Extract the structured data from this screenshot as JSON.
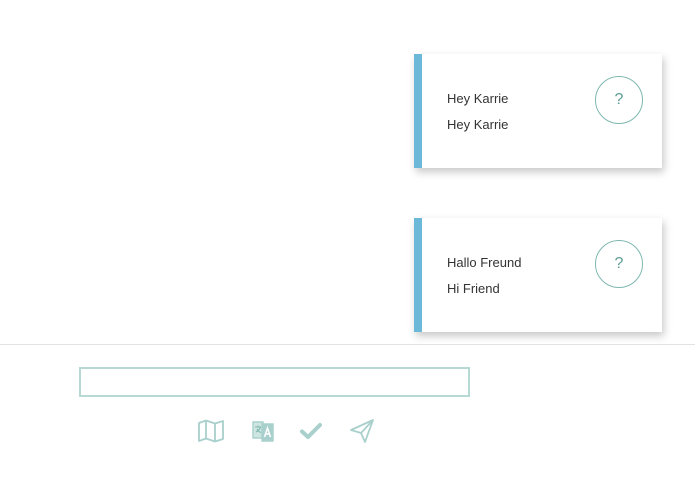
{
  "messages": [
    {
      "original": "Hey Karrie",
      "translation": "Hey Karrie",
      "help_label": "?"
    },
    {
      "original": "Hallo Freund",
      "translation": "Hi Friend",
      "help_label": "?"
    }
  ],
  "composer": {
    "value": "",
    "placeholder": ""
  },
  "toolbar": {
    "icons": [
      "map-icon",
      "translate-icon",
      "check-icon",
      "send-icon"
    ]
  },
  "colors": {
    "accent_bar": "#6bb8d9",
    "icon_teal": "#a9d0cc",
    "help_circle": "#7fb7b0",
    "input_border": "#b7d9d4"
  }
}
